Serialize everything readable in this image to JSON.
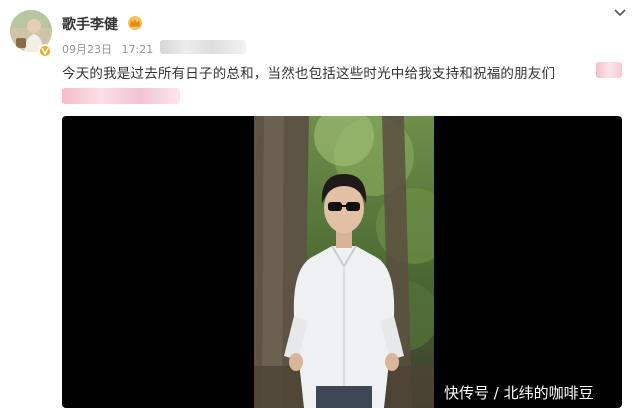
{
  "user": {
    "name": "歌手李健",
    "avatar_icon": "avatar-image",
    "verified_icon": "verified-badge-icon",
    "vip_icon": "crown-icon"
  },
  "meta": {
    "date": "09月23日",
    "time": "17:21"
  },
  "post": {
    "text": "今天的我是过去所有日子的总和，当然也包括这些时光中给我支持和祝福的朋友们"
  },
  "watermark": {
    "text": "快传号 / 北纬的咖啡豆"
  },
  "colors": {
    "name": "#333333",
    "meta": "#939393",
    "verified": "#f6a623",
    "video_bg": "#000000"
  }
}
